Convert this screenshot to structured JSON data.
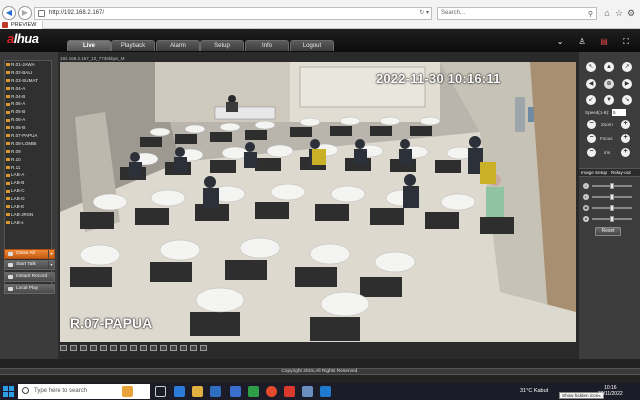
{
  "browser": {
    "url": "http://192.168.2.167/",
    "search_placeholder": "Search...",
    "tab_title": "PREVIEW"
  },
  "header": {
    "logo_prefix": "a",
    "logo_suffix": "lhua",
    "tabs": [
      "Live",
      "Playback",
      "Alarm",
      "Setup",
      "Info",
      "Logout"
    ],
    "active_tab": "Live"
  },
  "channels": [
    "R.01-JAWA",
    "R.02-BALI",
    "R.03-SUMAT",
    "R.04-A",
    "R.04-B",
    "R.05-A",
    "R.05-B",
    "R.06-A",
    "R.06-B",
    "R.07-PAPUA",
    "R.08-LOMBI",
    "R.09",
    "R.10",
    "R.11",
    "LAB-A",
    "LAB-B",
    "LAB-C",
    "LAB-D",
    "LAB-E",
    "LAB-JRSN",
    "LAB-x"
  ],
  "left_buttons": {
    "close_all": "Close All",
    "start_talk": "Start Talk",
    "instant_record": "Instant Record",
    "local_play": "Local Play"
  },
  "video": {
    "stream_info": "192.168.2.167_10_7736kbps_M",
    "timestamp": "2022-11-30  10:16:11",
    "location_label": "R.07-PAPUA"
  },
  "ptz": {
    "speed_label": "Speed(1-8):",
    "speed_value": "5",
    "zoom_label": "Zoom",
    "focus_label": "Focus",
    "iris_label": "Iris"
  },
  "image_setup": {
    "tab_image": "Image Setup",
    "tab_relay": "Relay-out",
    "reset_label": "Reset"
  },
  "footer": {
    "copyright": "Copyright 2015,All Rights Reserved."
  },
  "taskbar": {
    "search_placeholder": "Type here to search",
    "weather": "31°C  Kabut",
    "time": "10:16",
    "date": "30/11/2022",
    "hidden_icons_tip": "Show hidden icons"
  }
}
